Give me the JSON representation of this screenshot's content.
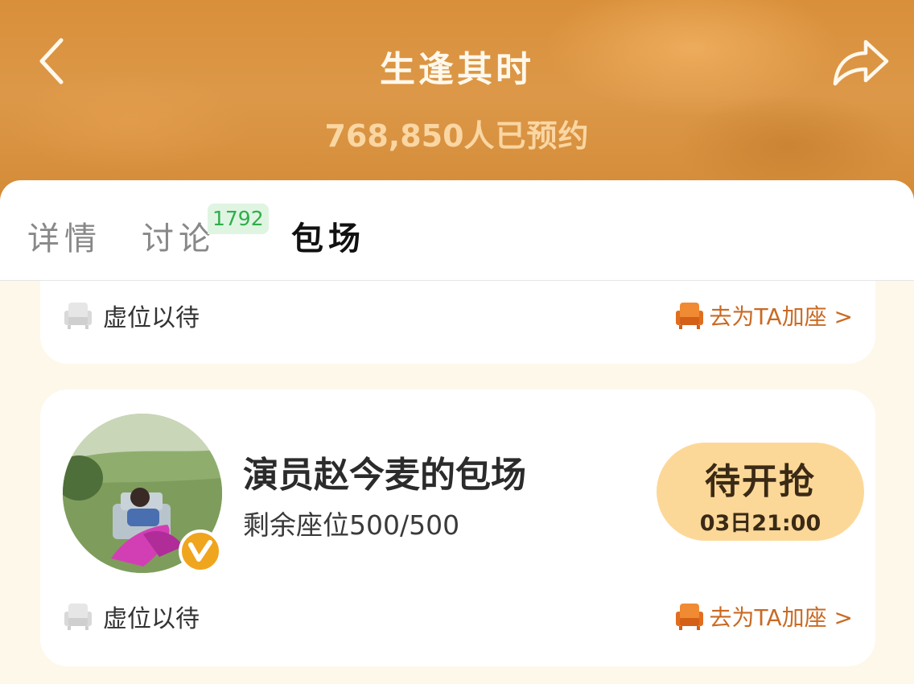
{
  "header": {
    "title": "生逢其时",
    "reservation_count": "768,850",
    "reservation_suffix": "人已预约",
    "back_icon": "chevron-left-icon",
    "share_icon": "share-arrow-icon"
  },
  "tabs": [
    {
      "label": "详情",
      "active": false
    },
    {
      "label": "讨论",
      "badge": "1792",
      "active": false
    },
    {
      "label": "包场",
      "active": true
    }
  ],
  "cards": [
    {
      "seat_status": "虚位以待",
      "add_seat_label": "去为TA加座 >"
    },
    {
      "name": "演员赵今麦的包场",
      "remaining_seats": "剩余座位500/500",
      "button_label": "待开抢",
      "button_time": "03日21:00",
      "verified_icon": "verified-v-badge-icon",
      "seat_status": "虚位以待",
      "add_seat_label": "去为TA加座 >"
    }
  ],
  "colors": {
    "header_orange": "#d98f3a",
    "accent_orange": "#c96a24",
    "button_yellow": "#fcd898",
    "badge_green": "#2fae4a",
    "page_bg": "#fdf8ea"
  }
}
